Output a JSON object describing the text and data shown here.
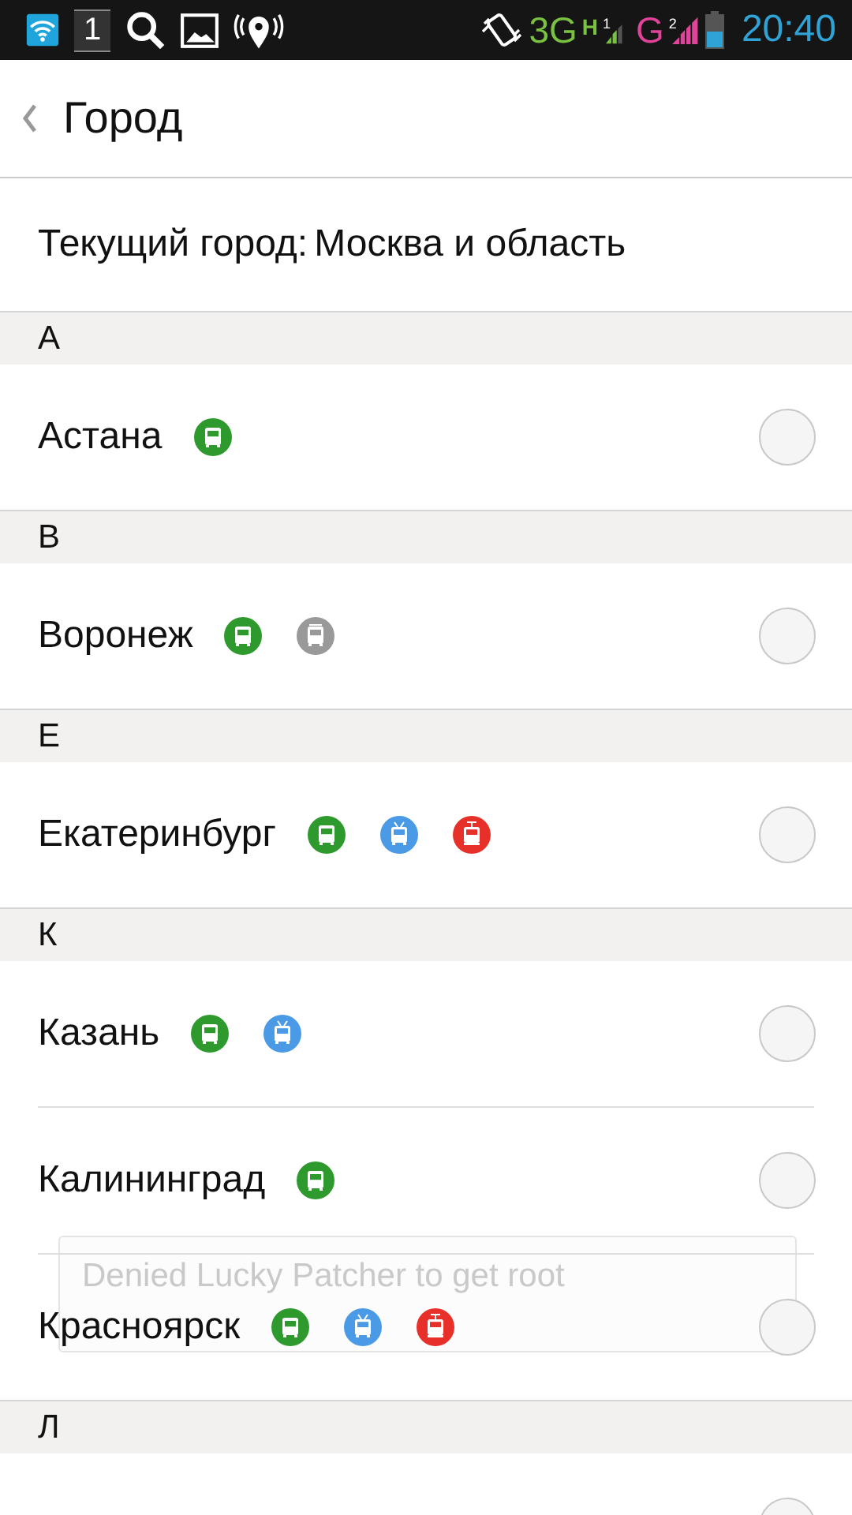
{
  "status_bar": {
    "notification_count": "1",
    "network_1": {
      "type": "3G",
      "sub": "H",
      "sim": "1"
    },
    "network_2": {
      "type": "G",
      "sim": "2"
    },
    "time": "20:40"
  },
  "header": {
    "title": "Город"
  },
  "current_city": {
    "label": "Текущий город:",
    "value": "Москва и область"
  },
  "sections": [
    {
      "letter": "А",
      "cities": [
        {
          "name": "Астана",
          "selected": false,
          "transports": [
            {
              "kind": "bus",
              "color": "#2e9a2e"
            }
          ]
        }
      ]
    },
    {
      "letter": "В",
      "cities": [
        {
          "name": "Воронеж",
          "selected": false,
          "transports": [
            {
              "kind": "bus",
              "color": "#2e9a2e"
            },
            {
              "kind": "minibus",
              "color": "#999999"
            }
          ]
        }
      ]
    },
    {
      "letter": "Е",
      "cities": [
        {
          "name": "Екатеринбург",
          "selected": false,
          "transports": [
            {
              "kind": "bus",
              "color": "#2e9a2e"
            },
            {
              "kind": "trolleybus",
              "color": "#4a9ae6"
            },
            {
              "kind": "tram",
              "color": "#e8302a"
            }
          ]
        }
      ]
    },
    {
      "letter": "К",
      "cities": [
        {
          "name": "Казань",
          "selected": false,
          "transports": [
            {
              "kind": "bus",
              "color": "#2e9a2e"
            },
            {
              "kind": "trolleybus",
              "color": "#4a9ae6"
            }
          ]
        },
        {
          "name": "Калининград",
          "selected": false,
          "transports": [
            {
              "kind": "bus",
              "color": "#2e9a2e"
            }
          ]
        },
        {
          "name": "Красноярск",
          "selected": false,
          "transports": [
            {
              "kind": "bus",
              "color": "#2e9a2e"
            },
            {
              "kind": "trolleybus",
              "color": "#4a9ae6"
            },
            {
              "kind": "tram",
              "color": "#e8302a"
            }
          ]
        }
      ]
    },
    {
      "letter": "Л",
      "cities": [
        {
          "selected": false
        }
      ]
    }
  ],
  "toast": {
    "text": "Denied Lucky Patcher to get root"
  }
}
